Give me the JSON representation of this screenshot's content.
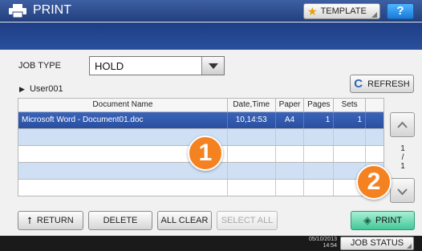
{
  "header": {
    "title": "PRINT",
    "template_label": "TEMPLATE",
    "help_label": "?"
  },
  "job_type": {
    "label": "JOB TYPE",
    "selected": "HOLD"
  },
  "user": {
    "name": "User001"
  },
  "refresh_label": "REFRESH",
  "table": {
    "columns": [
      "Document Name",
      "Date,Time",
      "Paper",
      "Pages",
      "Sets"
    ],
    "rows": [
      {
        "document": "Microsoft Word - Document01.doc",
        "datetime": "10,14:53",
        "paper": "A4",
        "pages": "1",
        "sets": "1"
      }
    ]
  },
  "pagination": {
    "current": "1",
    "separator": "/",
    "total": "1"
  },
  "callouts": {
    "first": "1",
    "second": "2"
  },
  "buttons": {
    "return": "RETURN",
    "delete": "DELETE",
    "all_clear": "ALL CLEAR",
    "select_all": "SELECT ALL",
    "print": "PRINT"
  },
  "footer": {
    "date": "05/10/2013",
    "time": "14:54",
    "job_status": "JOB STATUS"
  },
  "colors": {
    "header": "#2d4d90",
    "selected_row": "#2f56a8",
    "alt_row": "#cfe0f4",
    "print_button": "#5ed2a8",
    "callout": "#f58220"
  }
}
